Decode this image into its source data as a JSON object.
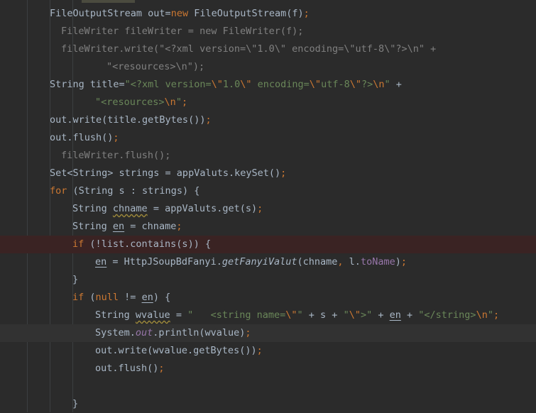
{
  "editor": {
    "lines": [
      {
        "indent": 70,
        "hl": "",
        "tokens": [
          {
            "t": "FileOutputStream out=",
            "c": ""
          },
          {
            "t": "new",
            "c": "kw"
          },
          {
            "t": " FileOutputStream(f)",
            "c": ""
          },
          {
            "t": ";",
            "c": "punct"
          }
        ]
      },
      {
        "indent": 86,
        "hl": "",
        "tokens": [
          {
            "t": "FileWriter fileWriter = new FileWriter(f);",
            "c": "comment"
          }
        ]
      },
      {
        "indent": 86,
        "hl": "",
        "tokens": [
          {
            "t": "fileWriter.write(\"<?xml version=\\\"1.0\\\" encoding=\\\"utf-8\\\"?>\\n\" +",
            "c": "comment"
          }
        ]
      },
      {
        "indent": 150,
        "hl": "",
        "tokens": [
          {
            "t": "\"<resources>\\n\");",
            "c": "comment"
          }
        ]
      },
      {
        "indent": 70,
        "hl": "",
        "tokens": [
          {
            "t": "String title=",
            "c": ""
          },
          {
            "t": "\"<?xml version=",
            "c": "str"
          },
          {
            "t": "\\\"",
            "c": "esc"
          },
          {
            "t": "1.0",
            "c": "str"
          },
          {
            "t": "\\\"",
            "c": "esc"
          },
          {
            "t": " encoding=",
            "c": "str"
          },
          {
            "t": "\\\"",
            "c": "esc"
          },
          {
            "t": "utf-8",
            "c": "str"
          },
          {
            "t": "\\\"",
            "c": "esc"
          },
          {
            "t": "?>",
            "c": "str"
          },
          {
            "t": "\\n",
            "c": "esc"
          },
          {
            "t": "\"",
            "c": "str"
          },
          {
            "t": " +",
            "c": ""
          }
        ]
      },
      {
        "indent": 134,
        "hl": "",
        "tokens": [
          {
            "t": "\"<resources>",
            "c": "str"
          },
          {
            "t": "\\n",
            "c": "esc"
          },
          {
            "t": "\"",
            "c": "str"
          },
          {
            "t": ";",
            "c": "punct"
          }
        ]
      },
      {
        "indent": 70,
        "hl": "",
        "tokens": [
          {
            "t": "out.write(title.getBytes())",
            "c": ""
          },
          {
            "t": ";",
            "c": "punct"
          }
        ]
      },
      {
        "indent": 70,
        "hl": "",
        "tokens": [
          {
            "t": "out.flush()",
            "c": ""
          },
          {
            "t": ";",
            "c": "punct"
          }
        ]
      },
      {
        "indent": 86,
        "hl": "",
        "tokens": [
          {
            "t": "fileWriter.flush();",
            "c": "comment"
          }
        ]
      },
      {
        "indent": 70,
        "hl": "",
        "tokens": [
          {
            "t": "Set<String> strings = appValuts.keySet()",
            "c": ""
          },
          {
            "t": ";",
            "c": "punct"
          }
        ]
      },
      {
        "indent": 70,
        "hl": "",
        "tokens": [
          {
            "t": "for",
            "c": "kw"
          },
          {
            "t": " (String s : strings) {",
            "c": ""
          }
        ]
      },
      {
        "indent": 102,
        "hl": "",
        "tokens": [
          {
            "t": "String ",
            "c": ""
          },
          {
            "t": "chname",
            "c": "warn"
          },
          {
            "t": " = appValuts.get(s)",
            "c": ""
          },
          {
            "t": ";",
            "c": "punct"
          }
        ]
      },
      {
        "indent": 102,
        "hl": "",
        "tokens": [
          {
            "t": "String ",
            "c": ""
          },
          {
            "t": "en",
            "c": "uline"
          },
          {
            "t": " = chname",
            "c": ""
          },
          {
            "t": ";",
            "c": "punct"
          }
        ]
      },
      {
        "indent": 102,
        "hl": "error",
        "tokens": [
          {
            "t": "if",
            "c": "kw"
          },
          {
            "t": " (!list.contains(s)) {",
            "c": ""
          }
        ]
      },
      {
        "indent": 134,
        "hl": "",
        "tokens": [
          {
            "t": "en",
            "c": "uline"
          },
          {
            "t": " = HttpJSoupBdFanyi.",
            "c": ""
          },
          {
            "t": "getFanyiValut",
            "c": "italic"
          },
          {
            "t": "(chname",
            "c": ""
          },
          {
            "t": ",",
            "c": "punct"
          },
          {
            "t": " l.",
            "c": ""
          },
          {
            "t": "toName",
            "c": "field"
          },
          {
            "t": ")",
            "c": ""
          },
          {
            "t": ";",
            "c": "punct"
          }
        ]
      },
      {
        "indent": 102,
        "hl": "",
        "tokens": [
          {
            "t": "}",
            "c": ""
          }
        ]
      },
      {
        "indent": 102,
        "hl": "",
        "tokens": [
          {
            "t": "if",
            "c": "kw"
          },
          {
            "t": " (",
            "c": ""
          },
          {
            "t": "null",
            "c": "kw"
          },
          {
            "t": " != ",
            "c": ""
          },
          {
            "t": "en",
            "c": "uline"
          },
          {
            "t": ") {",
            "c": ""
          }
        ]
      },
      {
        "indent": 134,
        "hl": "",
        "tokens": [
          {
            "t": "String ",
            "c": ""
          },
          {
            "t": "wvalue",
            "c": "warn"
          },
          {
            "t": " = ",
            "c": ""
          },
          {
            "t": "\"   <string name=",
            "c": "str"
          },
          {
            "t": "\\\"",
            "c": "esc"
          },
          {
            "t": "\"",
            "c": "str"
          },
          {
            "t": " + s + ",
            "c": ""
          },
          {
            "t": "\"",
            "c": "str"
          },
          {
            "t": "\\\"",
            "c": "esc"
          },
          {
            "t": ">\"",
            "c": "str"
          },
          {
            "t": " + ",
            "c": ""
          },
          {
            "t": "en",
            "c": "uline"
          },
          {
            "t": " + ",
            "c": ""
          },
          {
            "t": "\"</string>",
            "c": "str"
          },
          {
            "t": "\\n",
            "c": "esc"
          },
          {
            "t": "\"",
            "c": "str"
          },
          {
            "t": ";",
            "c": "punct"
          }
        ]
      },
      {
        "indent": 134,
        "hl": "caret",
        "tokens": [
          {
            "t": "System.",
            "c": ""
          },
          {
            "t": "out",
            "c": "static"
          },
          {
            "t": ".println(wvalue)",
            "c": ""
          },
          {
            "t": ";",
            "c": "punct"
          }
        ]
      },
      {
        "indent": 134,
        "hl": "",
        "tokens": [
          {
            "t": "out.write(wvalue.getBytes())",
            "c": ""
          },
          {
            "t": ";",
            "c": "punct"
          }
        ]
      },
      {
        "indent": 134,
        "hl": "",
        "tokens": [
          {
            "t": "out.flush()",
            "c": ""
          },
          {
            "t": ";",
            "c": "punct"
          }
        ]
      },
      {
        "indent": 134,
        "hl": "",
        "tokens": []
      },
      {
        "indent": 102,
        "hl": "",
        "tokens": [
          {
            "t": "}",
            "c": ""
          }
        ]
      }
    ]
  },
  "colors": {
    "background": "#2b2b2b",
    "text": "#a9b7c6",
    "keyword": "#cc7832",
    "string": "#6a8759",
    "comment": "#808080",
    "field": "#9876aa",
    "error_line": "#3a2323",
    "caret_line": "#323232"
  }
}
